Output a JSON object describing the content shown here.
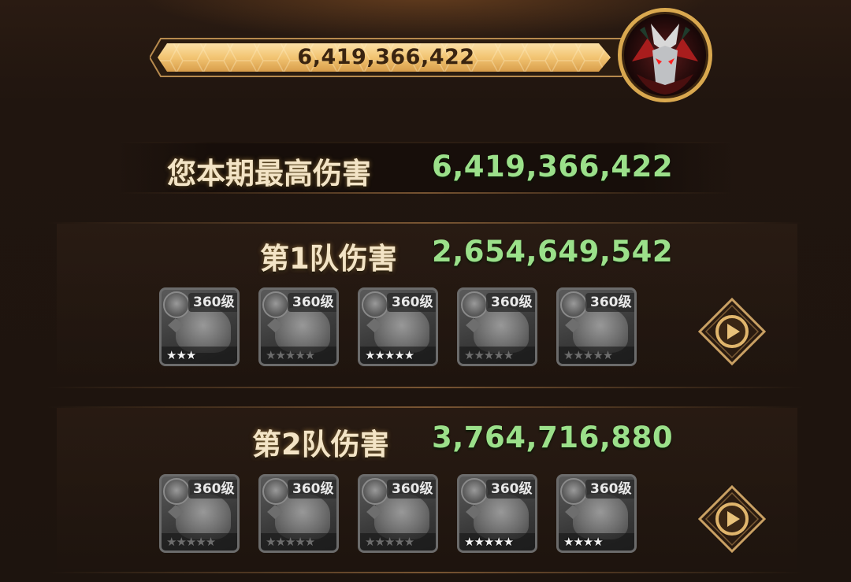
{
  "boss_bar": {
    "value": "6,419,366,422",
    "fill_fraction": 1.0,
    "boss_icon": "dragon-knight-boss-portrait"
  },
  "best_damage": {
    "label": "您本期最高伤害",
    "value": "6,419,366,422"
  },
  "teams": [
    {
      "label": "第1队伤害",
      "value": "2,654,649,542",
      "replay_icon": "play-icon",
      "heroes": [
        {
          "level": "360级",
          "stars_lit": 3,
          "stars_total": 3
        },
        {
          "level": "360级",
          "stars_lit": 0,
          "stars_total": 5
        },
        {
          "level": "360级",
          "stars_lit": 5,
          "stars_total": 5
        },
        {
          "level": "360级",
          "stars_lit": 0,
          "stars_total": 5
        },
        {
          "level": "360级",
          "stars_lit": 0,
          "stars_total": 5
        }
      ]
    },
    {
      "label": "第2队伤害",
      "value": "3,764,716,880",
      "replay_icon": "play-icon",
      "heroes": [
        {
          "level": "360级",
          "stars_lit": 0,
          "stars_total": 5
        },
        {
          "level": "360级",
          "stars_lit": 0,
          "stars_total": 5
        },
        {
          "level": "360级",
          "stars_lit": 0,
          "stars_total": 5
        },
        {
          "level": "360级",
          "stars_lit": 5,
          "stars_total": 5
        },
        {
          "level": "360级",
          "stars_lit": 4,
          "stars_total": 4
        }
      ]
    }
  ],
  "colors": {
    "value_green": "#9be08a",
    "label_cream": "#f3e4c6",
    "bar_gold": "#f2c472",
    "frame_gold": "#c9a063"
  }
}
